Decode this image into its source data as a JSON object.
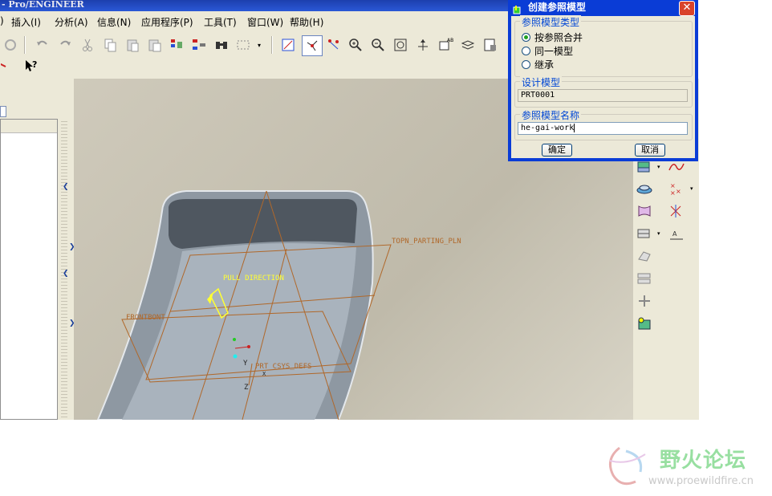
{
  "app": {
    "title": "- Pro/ENGINEER"
  },
  "menus": [
    {
      "id": "insert",
      "label": "插入(I)"
    },
    {
      "id": "analysis",
      "label": "分析(A)"
    },
    {
      "id": "info",
      "label": "信息(N)"
    },
    {
      "id": "applications",
      "label": "应用程序(P)"
    },
    {
      "id": "tools",
      "label": "工具(T)"
    },
    {
      "id": "window",
      "label": "窗口(W)"
    },
    {
      "id": "help",
      "label": "帮助(H)"
    }
  ],
  "viewport": {
    "labels": {
      "top_plane": "TOPN_PARTING_PLN",
      "pull_direction": "PULL DIRECTION",
      "front_plane": "FRONTBONT",
      "csys": "PRT_CSYS_DEFS",
      "axis_x": "X",
      "axis_y": "Y",
      "axis_z": "Z"
    }
  },
  "dialog": {
    "title": "创建参照模型",
    "close_label": "✕",
    "type_group": {
      "legend": "参照模型类型",
      "options": [
        {
          "label": "按参照合并",
          "selected": true
        },
        {
          "label": "同一模型",
          "selected": false
        },
        {
          "label": "继承",
          "selected": false
        }
      ]
    },
    "design_group": {
      "legend": "设计模型",
      "value": "PRT0001"
    },
    "name_group": {
      "legend": "参照模型名称",
      "value": "he-gai-work"
    },
    "ok_label": "确定",
    "cancel_label": "取消"
  },
  "watermark": {
    "name": "野火论坛",
    "url": "www.proewildfire.cn"
  },
  "colors": {
    "title_blue": "#2a58d6",
    "dialog_blue": "#0a3cd6",
    "datum_orange": "#b0682a",
    "pull_yellow": "#ffff33",
    "model_face": "#a9b3bd"
  }
}
